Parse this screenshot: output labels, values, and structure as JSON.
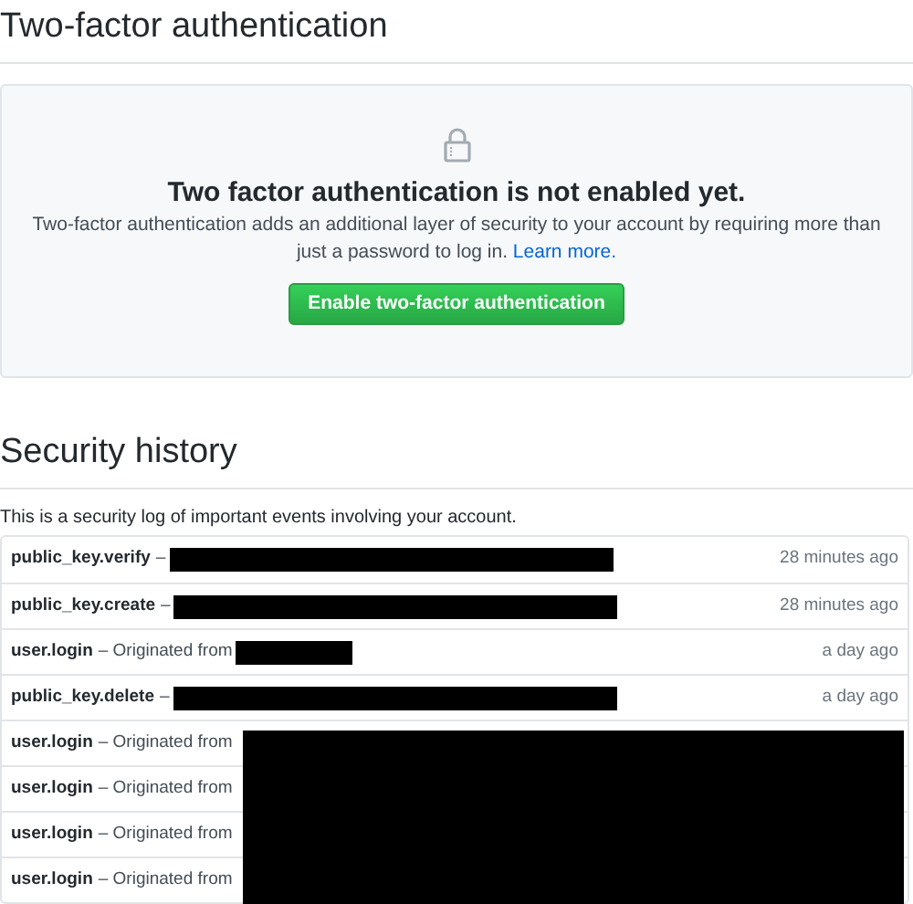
{
  "section_title": "Two-factor authentication",
  "blankslate": {
    "title": "Two factor authentication is not enabled yet.",
    "description": "Two-factor authentication adds an additional layer of security to your account by requiring more than just a password to log in.",
    "link": "Learn more.",
    "button": "Enable two-factor authentication"
  },
  "history_title": "Security history",
  "history_description": "This is a security log of important events involving your account.",
  "events": [
    {
      "kind": "key",
      "action": "public_key.verify",
      "detail": "–",
      "redacted": true,
      "covered": false,
      "time": "28 minutes ago"
    },
    {
      "kind": "key",
      "action": "public_key.create",
      "detail": "–",
      "redacted": true,
      "covered": false,
      "time": "28 minutes ago"
    },
    {
      "kind": "login",
      "action": "user.login",
      "detail": "– Originated from",
      "redacted": true,
      "covered": false,
      "time": "a day ago"
    },
    {
      "kind": "key",
      "action": "public_key.delete",
      "detail": "–",
      "redacted": true,
      "covered": false,
      "time": "a day ago"
    },
    {
      "kind": "login",
      "action": "user.login",
      "detail": "– Originated from",
      "redacted": false,
      "covered": true
    },
    {
      "kind": "login",
      "action": "user.login",
      "detail": "– Originated from",
      "redacted": false,
      "covered": true
    },
    {
      "kind": "login",
      "action": "user.login",
      "detail": "– Originated from",
      "redacted": false,
      "covered": true
    },
    {
      "kind": "login",
      "action": "user.login",
      "detail": "– Originated from",
      "redacted": false,
      "covered": true
    }
  ]
}
